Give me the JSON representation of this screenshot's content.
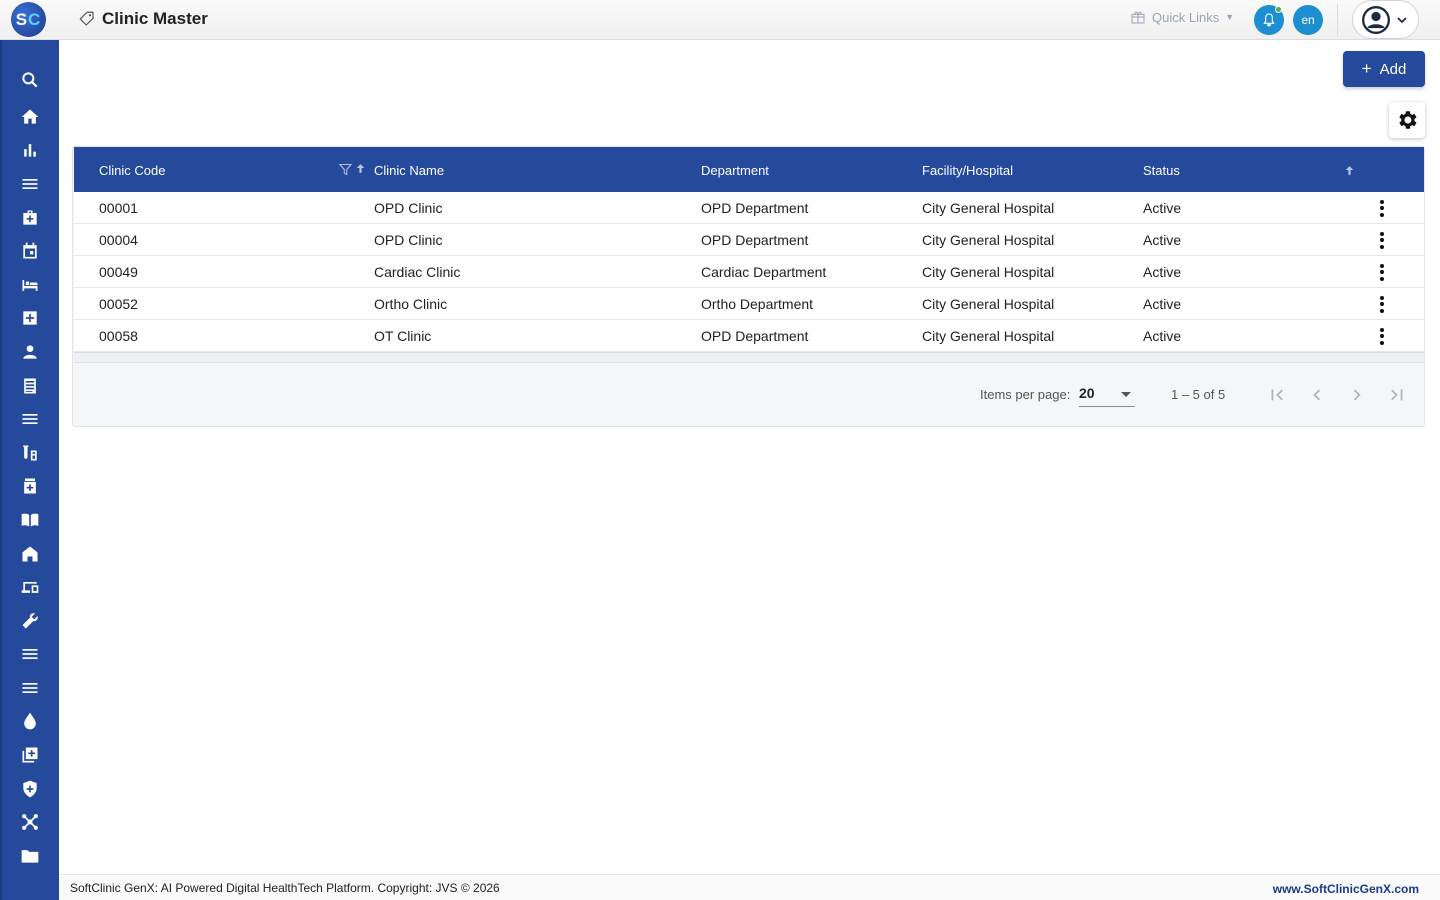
{
  "app": {
    "logo_text_s": "S",
    "logo_text_c": "C",
    "page_title": "Clinic Master"
  },
  "header": {
    "quick_links": "Quick Links",
    "language": "en",
    "accent": "#1d8fd0",
    "brand": "#254a9c"
  },
  "sidebar": {
    "items": [
      {
        "icon": "search-icon"
      },
      {
        "icon": "home-icon"
      },
      {
        "icon": "bar-chart-icon"
      },
      {
        "icon": "menu-icon"
      },
      {
        "icon": "medical-bag-icon"
      },
      {
        "icon": "calendar-icon"
      },
      {
        "icon": "bed-icon"
      },
      {
        "icon": "medical-plus-icon"
      },
      {
        "icon": "person-icon"
      },
      {
        "icon": "list-icon"
      },
      {
        "icon": "menu-icon"
      },
      {
        "icon": "lab-icon"
      },
      {
        "icon": "pharmacy-icon"
      },
      {
        "icon": "book-icon"
      },
      {
        "icon": "building-icon"
      },
      {
        "icon": "devices-icon"
      },
      {
        "icon": "wrench-icon"
      },
      {
        "icon": "menu-icon"
      },
      {
        "icon": "menu-icon"
      },
      {
        "icon": "drop-icon"
      },
      {
        "icon": "add-box-icon"
      },
      {
        "icon": "shield-icon"
      },
      {
        "icon": "network-icon"
      },
      {
        "icon": "folder-icon"
      }
    ]
  },
  "toolbar": {
    "add_label": "Add"
  },
  "table": {
    "columns": {
      "code": "Clinic Code",
      "name": "Clinic Name",
      "department": "Department",
      "facility": "Facility/Hospital",
      "status": "Status"
    },
    "rows": [
      {
        "code": "00001",
        "name": "OPD Clinic",
        "department": "OPD Department",
        "facility": "City General Hospital",
        "status": "Active"
      },
      {
        "code": "00004",
        "name": "OPD Clinic",
        "department": "OPD Department",
        "facility": "City General Hospital",
        "status": "Active"
      },
      {
        "code": "00049",
        "name": "Cardiac Clinic",
        "department": "Cardiac Department",
        "facility": "City General Hospital",
        "status": "Active"
      },
      {
        "code": "00052",
        "name": "Ortho Clinic",
        "department": "Ortho Department",
        "facility": "City General Hospital",
        "status": "Active"
      },
      {
        "code": "00058",
        "name": "OT Clinic",
        "department": "OPD Department",
        "facility": "City General Hospital",
        "status": "Active"
      }
    ]
  },
  "paginator": {
    "items_per_page_label": "Items per page:",
    "items_per_page_value": "20",
    "range_label": "1 – 5 of 5"
  },
  "footer": {
    "copyright": "SoftClinic GenX: AI Powered Digital HealthTech Platform. Copyright: JVS © 2026",
    "site": "www.SoftClinicGenX.com"
  }
}
